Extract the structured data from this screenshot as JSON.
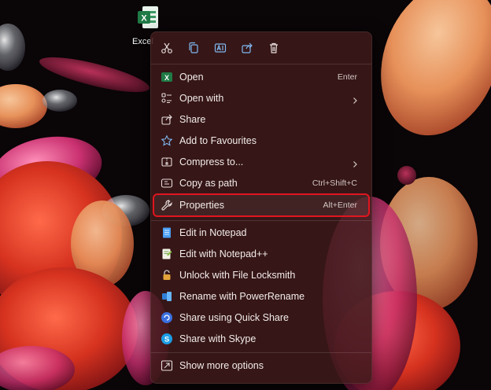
{
  "desktop": {
    "icon_label": "Excel",
    "icon": "excel-file-icon"
  },
  "quick_actions": [
    {
      "name": "cut",
      "icon": "scissors-icon"
    },
    {
      "name": "copy",
      "icon": "copy-icon"
    },
    {
      "name": "rename",
      "icon": "rename-icon"
    },
    {
      "name": "share",
      "icon": "share-icon"
    },
    {
      "name": "delete",
      "icon": "trash-icon"
    }
  ],
  "menu": {
    "open": {
      "label": "Open",
      "shortcut": "Enter",
      "icon": "excel-icon"
    },
    "open_with": {
      "label": "Open with",
      "icon": "open-with-icon"
    },
    "share": {
      "label": "Share",
      "icon": "share-icon"
    },
    "add_to_favourites": {
      "label": "Add to Favourites",
      "icon": "star-icon"
    },
    "compress_to": {
      "label": "Compress to...",
      "icon": "zip-icon"
    },
    "copy_as_path": {
      "label": "Copy as path",
      "shortcut": "Ctrl+Shift+C",
      "icon": "path-icon"
    },
    "properties": {
      "label": "Properties",
      "shortcut": "Alt+Enter",
      "icon": "wrench-icon"
    },
    "edit_notepad": {
      "label": "Edit in Notepad",
      "icon": "notepad-icon"
    },
    "edit_notepadpp": {
      "label": "Edit with Notepad++",
      "icon": "notepadpp-icon"
    },
    "unlock_locksmith": {
      "label": "Unlock with File Locksmith",
      "icon": "lock-icon"
    },
    "rename_powerrename": {
      "label": "Rename with PowerRename",
      "icon": "powerrename-icon"
    },
    "quick_share": {
      "label": "Share using Quick Share",
      "icon": "quick-share-icon"
    },
    "skype": {
      "label": "Share with Skype",
      "icon": "skype-icon"
    },
    "show_more": {
      "label": "Show more options",
      "icon": "show-more-icon"
    }
  },
  "colors": {
    "highlight_outline": "#e0161f",
    "excel_green": "#1f7a45",
    "accent_blue": "#4a9ff5"
  }
}
